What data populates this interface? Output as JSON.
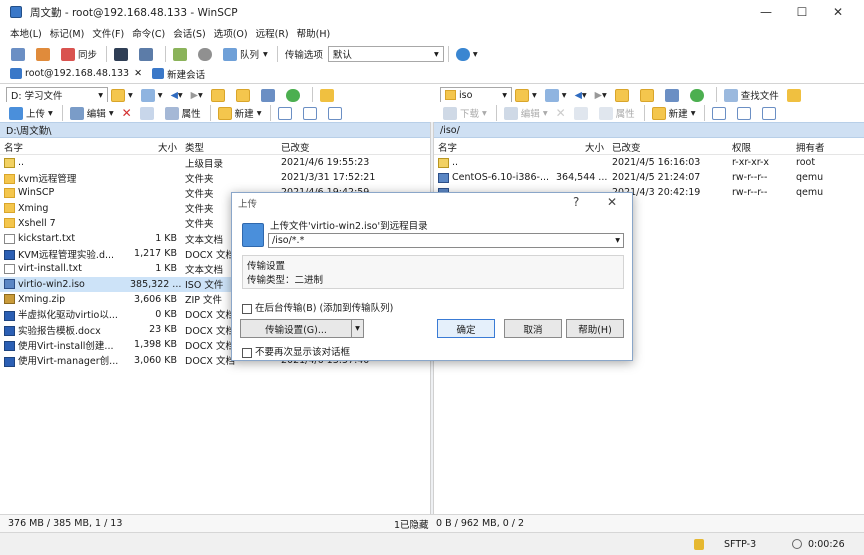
{
  "window": {
    "title": "周文勤 - root@192.168.48.133 - WinSCP",
    "minimize": "—",
    "maximize": "☐",
    "close": "✕"
  },
  "menu": [
    "本地(L)",
    "标记(M)",
    "文件(F)",
    "命令(C)",
    "会话(S)",
    "选项(O)",
    "远程(R)",
    "帮助(H)"
  ],
  "toolbar": {
    "sync": "同步",
    "queue": "队列",
    "transfer_options_label": "传输选项",
    "transfer_options_value": "默认"
  },
  "tabs": {
    "session": "root@192.168.48.133",
    "new_session": "新建会话"
  },
  "left": {
    "drive": "D: 学习文件",
    "upload": "上传",
    "edit": "编辑",
    "properties": "属性",
    "new": "新建",
    "path": "D:\\周文勤\\",
    "columns": {
      "name": "名字",
      "size": "大小",
      "type": "类型",
      "modified": "已改变"
    },
    "files": [
      {
        "name": "..",
        "size": "",
        "type": "上级目录",
        "modified": "2021/4/6  19:55:23",
        "icon": "up"
      },
      {
        "name": "kvm远程管理",
        "size": "",
        "type": "文件夹",
        "modified": "2021/3/31  17:52:21",
        "icon": "folder"
      },
      {
        "name": "WinSCP",
        "size": "",
        "type": "文件夹",
        "modified": "2021/4/6  19:42:59",
        "icon": "folder"
      },
      {
        "name": "Xming",
        "size": "",
        "type": "文件夹",
        "modified": "",
        "icon": "folder"
      },
      {
        "name": "Xshell 7",
        "size": "",
        "type": "文件夹",
        "modified": "",
        "icon": "folder"
      },
      {
        "name": "kickstart.txt",
        "size": "1 KB",
        "type": "文本文档",
        "modified": "",
        "icon": "txt"
      },
      {
        "name": "KVM远程管理实验.d...",
        "size": "1,217 KB",
        "type": "DOCX 文档",
        "modified": "",
        "icon": "docx"
      },
      {
        "name": "virt-install.txt",
        "size": "1 KB",
        "type": "文本文档",
        "modified": "",
        "icon": "txt"
      },
      {
        "name": "virtio-win2.iso",
        "size": "385,322 ...",
        "type": "ISO 文件",
        "modified": "",
        "icon": "iso"
      },
      {
        "name": "Xming.zip",
        "size": "3,606 KB",
        "type": "ZIP 文件",
        "modified": "",
        "icon": "zip"
      },
      {
        "name": "半虚拟化驱动virtio以...",
        "size": "0 KB",
        "type": "DOCX 文档",
        "modified": "",
        "icon": "docx"
      },
      {
        "name": "实验报告模板.docx",
        "size": "23 KB",
        "type": "DOCX 文档",
        "modified": "",
        "icon": "docx"
      },
      {
        "name": "使用Virt-install创建...",
        "size": "1,398 KB",
        "type": "DOCX 文档",
        "modified": "",
        "icon": "docx"
      },
      {
        "name": "使用Virt-manager创...",
        "size": "3,060 KB",
        "type": "DOCX 文档",
        "modified": "2021/4/6  13:57:40",
        "icon": "docx"
      }
    ],
    "status": "376 MB / 385 MB,  1 / 13"
  },
  "right": {
    "drive": "iso",
    "download": "下载",
    "edit": "编辑",
    "properties": "属性",
    "new": "新建",
    "find": "查找文件",
    "path": "/iso/",
    "columns": {
      "name": "名字",
      "size": "大小",
      "modified": "已改变",
      "rights": "权限",
      "owner": "拥有者"
    },
    "files": [
      {
        "name": "..",
        "size": "",
        "modified": "2021/4/5  16:16:03",
        "rights": "r-xr-xr-x",
        "owner": "root",
        "icon": "up"
      },
      {
        "name": "CentOS-6.10-i386-...",
        "size": "364,544 ...",
        "modified": "2021/4/5  21:24:07",
        "rights": "rw-r--r--",
        "owner": "qemu",
        "icon": "iso"
      },
      {
        "name": "",
        "size": "",
        "modified": "2021/4/3  20:42:19",
        "rights": "rw-r--r--",
        "owner": "qemu",
        "icon": "iso"
      }
    ],
    "hidden": "1已隐藏",
    "status": "0 B / 962 MB,  0 / 2"
  },
  "statusbar": {
    "protocol": "SFTP-3",
    "time": "0:00:26"
  },
  "dialog": {
    "title": "上传",
    "help_q": "?",
    "close": "✕",
    "prompt": "上传文件'virtio-win2.iso'到远程目录",
    "target": "/iso/*.*",
    "settings_heading": "传输设置",
    "settings_value": "传输类型：二进制",
    "background_check": "在后台传输(B) (添加到传输队列)",
    "transfer_settings_button": "传输设置(G)...",
    "ok": "确定",
    "cancel": "取消",
    "help": "帮助(H)",
    "dont_show": "不要再次显示该对话框"
  }
}
